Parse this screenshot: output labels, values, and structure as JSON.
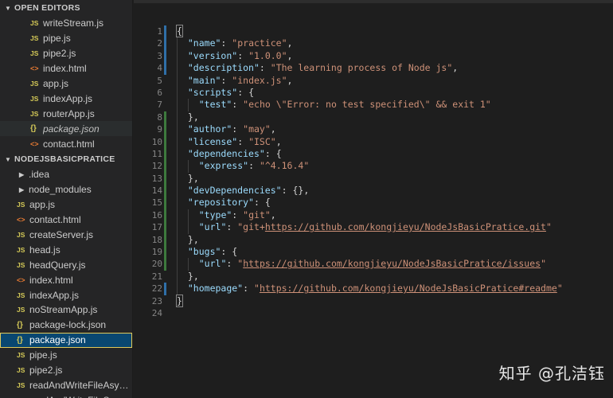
{
  "explorer": {
    "open_editors": {
      "title": "OPEN EDITORS",
      "items": [
        {
          "label": "writeStream.js",
          "type": "js"
        },
        {
          "label": "pipe.js",
          "type": "js"
        },
        {
          "label": "pipe2.js",
          "type": "js"
        },
        {
          "label": "index.html",
          "type": "html"
        },
        {
          "label": "app.js",
          "type": "js"
        },
        {
          "label": "indexApp.js",
          "type": "js"
        },
        {
          "label": "routerApp.js",
          "type": "js"
        },
        {
          "label": "package.json",
          "type": "json",
          "active": true
        },
        {
          "label": "contact.html",
          "type": "html"
        }
      ]
    },
    "project": {
      "title": "NODEJSBASICPRATICE",
      "items": [
        {
          "label": ".idea",
          "type": "folder"
        },
        {
          "label": "node_modules",
          "type": "folder"
        },
        {
          "label": "app.js",
          "type": "js"
        },
        {
          "label": "contact.html",
          "type": "html"
        },
        {
          "label": "createServer.js",
          "type": "js"
        },
        {
          "label": "head.js",
          "type": "js"
        },
        {
          "label": "headQuery.js",
          "type": "js"
        },
        {
          "label": "index.html",
          "type": "html"
        },
        {
          "label": "indexApp.js",
          "type": "js"
        },
        {
          "label": "noStreamApp.js",
          "type": "js"
        },
        {
          "label": "package-lock.json",
          "type": "json"
        },
        {
          "label": "package.json",
          "type": "json",
          "selected": true
        },
        {
          "label": "pipe.js",
          "type": "js"
        },
        {
          "label": "pipe2.js",
          "type": "js"
        },
        {
          "label": "readAndWriteFileAsync...",
          "type": "js"
        },
        {
          "label": "readAndWriteFileSync.js",
          "type": "js"
        }
      ]
    },
    "icons": {
      "js": "JS",
      "html": "<>",
      "json": "{}",
      "folder": "▶",
      "caret": "▼"
    }
  },
  "editor": {
    "line_numbers": [
      "1",
      "2",
      "3",
      "4",
      "5",
      "6",
      "7",
      "8",
      "9",
      "10",
      "11",
      "12",
      "13",
      "14",
      "15",
      "16",
      "17",
      "18",
      "19",
      "20",
      "21",
      "22",
      "23",
      "24"
    ],
    "lines": [
      "{",
      "  \"name\": \"practice\",",
      "  \"version\": \"1.0.0\",",
      "  \"description\": \"The learning process of Node js\",",
      "  \"main\": \"index.js\",",
      "  \"scripts\": {",
      "    \"test\": \"echo \\\"Error: no test specified\\\" && exit 1\"",
      "  },",
      "  \"author\": \"may\",",
      "  \"license\": \"ISC\",",
      "  \"dependencies\": {",
      "    \"express\": \"^4.16.4\"",
      "  },",
      "  \"devDependencies\": {},",
      "  \"repository\": {",
      "    \"type\": \"git\",",
      "    \"url\": \"git+https://github.com/kongjieyu/NodeJsBasicPratice.git\"",
      "  },",
      "  \"bugs\": {",
      "    \"url\": \"https://github.com/kongjieyu/NodeJsBasicPratice/issues\"",
      "  },",
      "  \"homepage\": \"https://github.com/kongjieyu/NodeJsBasicPratice#readme\"",
      "}",
      ""
    ],
    "gutter_marks": [
      "blue",
      "blue",
      "blue",
      "blue",
      "",
      "",
      "",
      "green",
      "green",
      "green",
      "green",
      "green",
      "green",
      "green",
      "green",
      "green",
      "green",
      "green",
      "green",
      "green",
      "",
      "blue",
      "",
      ""
    ],
    "colors": {
      "key": "#9cdcfe",
      "string": "#ce9178",
      "punct": "#d4d4d4",
      "mark_blue": "#2f6fa8",
      "mark_green": "#3d7a3d",
      "selection": "#094771"
    }
  },
  "watermark": "知乎 @孔洁钰"
}
